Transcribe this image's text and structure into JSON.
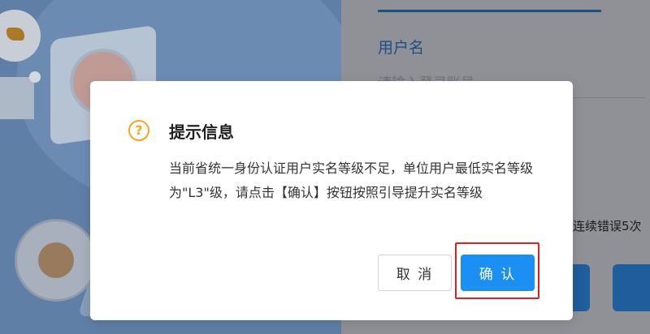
{
  "login": {
    "username_label": "用户名",
    "username_placeholder": "请输入登录账号",
    "hint_text": "连续错误5次"
  },
  "dialog": {
    "icon": "question-circle-icon",
    "icon_glyph": "?",
    "title": "提示信息",
    "message": "当前省统一身份认证用户实名等级不足，单位用户最低实名等级为\"L3\"级，请点击【确认】按钮按照引导提升实名等级",
    "cancel_label": "取 消",
    "confirm_label": "确 认"
  },
  "colors": {
    "accent": "#1c8ff2",
    "warning_icon": "#f5a623",
    "highlight_border": "#e02020",
    "brand_blue": "#1d4f86"
  }
}
